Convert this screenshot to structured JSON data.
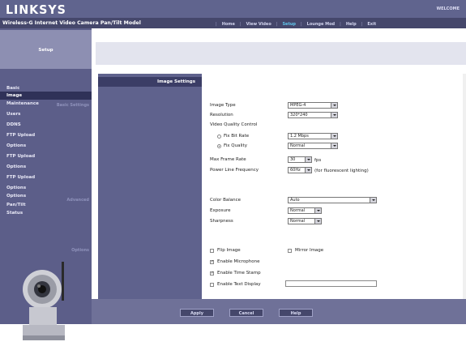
{
  "header": {
    "logo": "LINKSYS",
    "welcome": "WELCOME",
    "model": "Wireless-G Internet Video Camera Pan/Tilt Model",
    "nav": [
      "Home",
      "View Video",
      "Setup",
      "Lounge Mod",
      "Help",
      "Exit"
    ],
    "nav_active": "Setup"
  },
  "sidebar": {
    "title": "Setup",
    "items": [
      "Basic",
      "Image",
      "Maintenance",
      "Users",
      "DDNS",
      "FTP Upload",
      "Options",
      "FTP Upload",
      "Options",
      "FTP Upload",
      "Options",
      "Options",
      "Pan/Tilt",
      "Status"
    ],
    "active_index": 1
  },
  "section": {
    "title": "Image Settings",
    "labels": [
      "Basic Settings",
      "Advanced",
      "Options"
    ]
  },
  "form": {
    "image_type_label": "Image Type",
    "image_type": "MPEG-4",
    "resolution_label": "Resolution",
    "resolution": "320*240",
    "video_quality_label": "Video Quality Control",
    "fix_bitrate_label": "Fix Bit Rate",
    "fix_bitrate_value": "1.2 Mbps",
    "fix_quality_label": "Fix Quality",
    "fix_quality_value": "Normal",
    "max_frame_label": "Max Frame Rate",
    "max_frame_value": "30",
    "max_frame_unit": "fps",
    "power_freq_label": "Power Line Frequency",
    "power_freq_value": "60Hz",
    "power_freq_note": "(for fluorescent lighting)",
    "color_balance_label": "Color Balance",
    "color_balance_value": "Auto",
    "exposure_label": "Exposure",
    "exposure_value": "Normal",
    "sharpness_label": "Sharpness",
    "sharpness_value": "Normal",
    "flip_label": "Flip Image",
    "mirror_label": "Mirror Image",
    "mic_label": "Enable Microphone",
    "timestamp_label": "Enable Time Stamp",
    "textdisplay_label": "Enable Text Display",
    "textdisplay_value": ""
  },
  "buttons": {
    "apply": "Apply",
    "cancel": "Cancel",
    "help": "Help"
  },
  "colors": {
    "banner": "#60648e",
    "modelbar": "#45476b",
    "sidebar": "#5c5e89",
    "active_nav": "#60c4ea"
  }
}
